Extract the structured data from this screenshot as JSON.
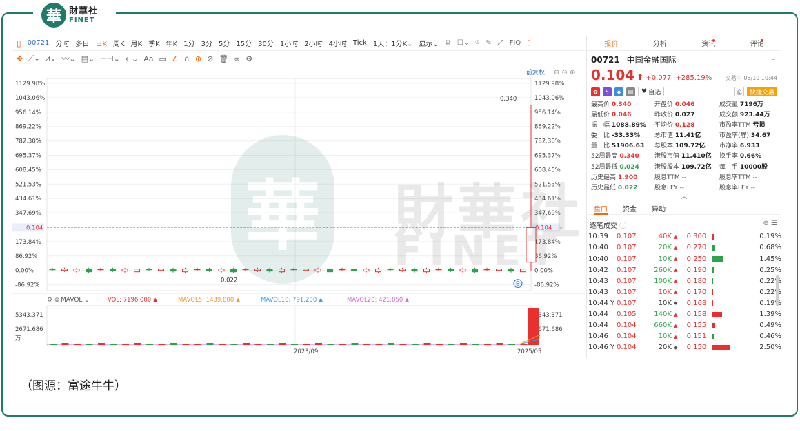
{
  "brand": {
    "mark": "華",
    "name_cn": "財華社",
    "name_en": "FINET"
  },
  "toolbar": {
    "code": "00721",
    "periods": [
      "分时",
      "多日",
      "日K",
      "周K",
      "月K",
      "季K",
      "年K",
      "1分",
      "3分",
      "5分",
      "15分",
      "30分",
      "1小时",
      "2小时",
      "4小时",
      "Tick"
    ],
    "active_period": "日K",
    "day_select": "1天：1分K",
    "show_label": "显示",
    "fq_label": "FIQ"
  },
  "drawing_tools": {
    "text_tool": "Aa"
  },
  "chart": {
    "adjust_label": "前复权",
    "y_ticks": [
      "1129.98%",
      "1043.06%",
      "956.14%",
      "869.22%",
      "782.30%",
      "695.37%",
      "608.45%",
      "521.53%",
      "434.61%",
      "347.69%",
      "260.77%",
      "173.84%",
      "86.92%",
      "0.00%",
      "-86.92%"
    ],
    "y_tick_values": [
      1129.98,
      1043.06,
      956.14,
      869.22,
      782.3,
      695.37,
      608.45,
      521.53,
      434.61,
      347.69,
      260.77,
      173.84,
      86.92,
      0.0,
      -86.92
    ],
    "current_price_label": "0.104",
    "current_price_pct": 173.84,
    "high_label": "0.340",
    "low_label": "0.022",
    "x_labels": [
      "2023/09",
      "2025/05"
    ],
    "e_badge": "E"
  },
  "volume": {
    "indicator": "MAVOL",
    "vol": "VOL: 7196.000",
    "ma5": "MAVOL5: 1439.800",
    "ma10": "MAVOL10: 791.200",
    "ma20": "MAVOL20: 421.850",
    "y_ticks": [
      "5343.371",
      "2671.686",
      "万"
    ],
    "colors": {
      "vol": "#e8302f",
      "ma5": "#f29a2e",
      "ma10": "#3aa0e0",
      "ma20": "#d56bd6"
    }
  },
  "panel": {
    "tabs": [
      {
        "label": "报价",
        "dot": false
      },
      {
        "label": "分析",
        "dot": false
      },
      {
        "label": "资讯",
        "dot": true
      },
      {
        "label": "评论",
        "dot": true
      }
    ],
    "code": "00721",
    "name": "中国金融国际",
    "price": "0.104",
    "change": "+0.077",
    "change_pct": "+285.19%",
    "time": "交易中 05/19 10:44",
    "watch": "自选",
    "quick_trade": "快捷交易",
    "stats": [
      {
        "label": "最高价",
        "value": "0.340",
        "cls": "red"
      },
      {
        "label": "开盘价",
        "value": "0.046",
        "cls": "red"
      },
      {
        "label": "成交量",
        "value": "7196万",
        "cls": ""
      },
      {
        "label": "最低价",
        "value": "0.046",
        "cls": "red"
      },
      {
        "label": "昨收价",
        "value": "0.027",
        "cls": ""
      },
      {
        "label": "成交额",
        "value": "923.44万",
        "cls": ""
      },
      {
        "label": "振　幅",
        "value": "1088.89%",
        "cls": ""
      },
      {
        "label": "平均价",
        "value": "0.128",
        "cls": "red"
      },
      {
        "label": "市盈率TTM",
        "value": "亏损",
        "cls": ""
      },
      {
        "label": "委　比",
        "value": "-33.33%",
        "cls": ""
      },
      {
        "label": "总市值",
        "value": "11.41亿",
        "cls": ""
      },
      {
        "label": "市盈率(静)",
        "value": "34.67",
        "cls": ""
      },
      {
        "label": "量　比",
        "value": "51906.63",
        "cls": ""
      },
      {
        "label": "总股本",
        "value": "109.72亿",
        "cls": ""
      },
      {
        "label": "市净率",
        "value": "6.933",
        "cls": ""
      },
      {
        "label": "52周最高",
        "value": "0.340",
        "cls": "red"
      },
      {
        "label": "港股市值",
        "value": "11.410亿",
        "cls": ""
      },
      {
        "label": "换手率",
        "value": "0.66%",
        "cls": ""
      },
      {
        "label": "52周最低",
        "value": "0.024",
        "cls": "green"
      },
      {
        "label": "港股股本",
        "value": "109.72亿",
        "cls": ""
      },
      {
        "label": "每　手",
        "value": "10000股",
        "cls": ""
      },
      {
        "label": "历史最高",
        "value": "1.900",
        "cls": "red"
      },
      {
        "label": "股息TTM",
        "value": "--",
        "cls": "gray"
      },
      {
        "label": "股息率TTM",
        "value": "--",
        "cls": "gray"
      },
      {
        "label": "历史最低",
        "value": "0.022",
        "cls": "green"
      },
      {
        "label": "股息LFY",
        "value": "--",
        "cls": "gray"
      },
      {
        "label": "股息率LFY",
        "value": "--",
        "cls": "gray"
      }
    ],
    "sub_tabs": [
      "盘口",
      "资金",
      "异动"
    ],
    "ticks_title": "逐笔成交",
    "ticks": [
      {
        "time": "10:39",
        "price": "0.107",
        "vol": "40K",
        "dir": "up",
        "pct": "0.300",
        "share": "0.19%",
        "bar": 0.03,
        "barColor": "#e8302f"
      },
      {
        "time": "10:40",
        "price": "0.107",
        "vol": "20K",
        "dir": "down",
        "pct": "0.270",
        "share": "0.68%",
        "bar": 0.05,
        "barColor": "#2aa44a"
      },
      {
        "time": "10:40",
        "price": "0.107",
        "vol": "10K",
        "dir": "down",
        "pct": "0.250",
        "share": "1.45%",
        "bar": 0.14,
        "barColor": "#2aa44a"
      },
      {
        "time": "10:42",
        "price": "0.107",
        "vol": "260K",
        "dir": "down",
        "pct": "0.190",
        "share": "0.25%",
        "bar": 0.03,
        "barColor": "#2aa44a"
      },
      {
        "time": "10:43",
        "price": "0.107",
        "vol": "100K",
        "dir": "down",
        "pct": "0.180",
        "share": "0.22%",
        "bar": 0.02,
        "barColor": "#2aa44a"
      },
      {
        "time": "10:43",
        "price": "0.107",
        "vol": "10K",
        "dir": "up",
        "pct": "0.170",
        "share": "0.22%",
        "bar": 0.02,
        "barColor": "#e8302f"
      },
      {
        "time": "10:44 Y",
        "price": "0.107",
        "vol": "10K",
        "dir": "flat",
        "pct": "0.168",
        "share": "0.19%",
        "bar": 0.02,
        "barColor": "#e8302f"
      },
      {
        "time": "10:44",
        "price": "0.105",
        "vol": "140K",
        "dir": "down",
        "pct": "0.158",
        "share": "1.39%",
        "bar": 0.13,
        "barColor": "#e8302f"
      },
      {
        "time": "10:44",
        "price": "0.104",
        "vol": "660K",
        "dir": "down",
        "pct": "0.155",
        "share": "0.49%",
        "bar": 0.05,
        "barColor": "#e8302f"
      },
      {
        "time": "10:46",
        "price": "0.104",
        "vol": "10K",
        "dir": "down",
        "pct": "0.151",
        "share": "0.46%",
        "bar": 0.04,
        "barColor": "#2aa44a"
      },
      {
        "time": "10:46 Y",
        "price": "0.104",
        "vol": "20K",
        "dir": "flat",
        "pct": "0.150",
        "share": "2.50%",
        "bar": 0.24,
        "barColor": "#e8302f"
      }
    ]
  },
  "caption": "（图源：富途牛牛）"
}
